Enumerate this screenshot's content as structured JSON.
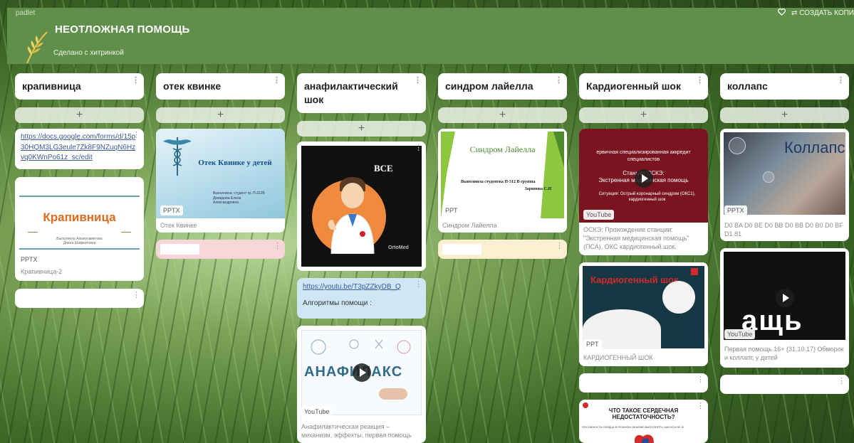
{
  "app": {
    "brand": "padlet",
    "heart_icon": "heart-icon",
    "create_label": "⇄ СОЗДАТЬ КОПИ"
  },
  "board": {
    "title": "НЕОТЛОЖНАЯ ПОМОЩЬ",
    "subtitle": "Сделано с хитринкой"
  },
  "colors": {
    "header": "#5f8f4a",
    "card": "#ffffff",
    "pink": "#f8d5d8",
    "yellow": "#fcefd0",
    "blue": "#cfe6f5"
  },
  "columns": [
    {
      "title": "крапивница"
    },
    {
      "title": "отек квинке"
    },
    {
      "title": "анафилактический шок"
    },
    {
      "title": "синдром лайелла"
    },
    {
      "title": "Кардиогенный шок"
    },
    {
      "title": "коллапс"
    }
  ],
  "add_label": "+",
  "kebab": "⋮",
  "col1": {
    "link": "https://docs.google.com/forms/d/15p30HQM3LG3eule7Zk8F9NZuqN6Hzvq0KWnPo61z_sc/edit",
    "slide_title": "Крапивница",
    "slide_sub1": "Выполнила Альмухаметова",
    "slide_sub2": "Диана Шафкатовна",
    "type": "PPTX",
    "caption": "Крапивница-2"
  },
  "col2": {
    "slide_title": "Отек Квинке у детей",
    "slide_sub1": "Выполнила: студент гр. П-312Б",
    "slide_sub2": "Демидова Елена",
    "slide_sub3": "Александровна",
    "type": "PPTX",
    "caption": "Отек Квинке"
  },
  "col3": {
    "badge": "ВСЕ",
    "watermark": "OrtoMed",
    "link": "https://youtu.be/T3pZZkyDB_Q",
    "link_text": "Алгоритмы помощи :",
    "video_title": "АНАФИЛАКС",
    "type": "YouTube",
    "caption": "Анафилактическая реакция – механизм, эффекты, первая помощь"
  },
  "col4": {
    "slide_title": "Синдром Лайелла",
    "slide_sub1": "Выполнила студентка П-512 В группы",
    "slide_sub2": "Зарипова С.И",
    "type": "PPT",
    "caption": "Синдром Лайелла"
  },
  "col5": {
    "video_line1": "ервичная специализированная аккредит",
    "video_line2": "специалистов",
    "video_line3": "Станция ОСКЭ:",
    "video_line4": "Экстренная медицинская помощь",
    "video_line5": "Ситуация: Острый коронарный синдром (ОКС1), кардиогенный шок",
    "type1": "YouTube",
    "caption1": "ОСКЭ: Прохождение станции: \"Экстренная медицинская помощь\" (ПСА), ОКС кардиогенный шок.",
    "slide_title": "Кардиогенный шок",
    "type2": "PPT",
    "caption2": "КАРДИОГЕННЫЙ ШОК",
    "poster_title": "ЧТО ТАКОЕ СЕРДЕЧНАЯ НЕДОСТАТОЧНОСТЬ?",
    "poster_sub": "ПОСОБНОСТЬ СЕРДЦА В ПОЛНОМ ОБЪЕМЕ ВЫПОЛНЯТЬ НАСОСНУЮ Ф"
  },
  "col6": {
    "slide_title": "Коллапс",
    "type1": "PPTX",
    "caption1": "D0 BA D0 BE D0 BB D0 BB D0 B0 D0 BF D1 81",
    "video_text": "ащь",
    "type2": "YouTube",
    "caption2": "Первая помощь 16+ (31.10.17) Обморок и коллапс у детей"
  }
}
